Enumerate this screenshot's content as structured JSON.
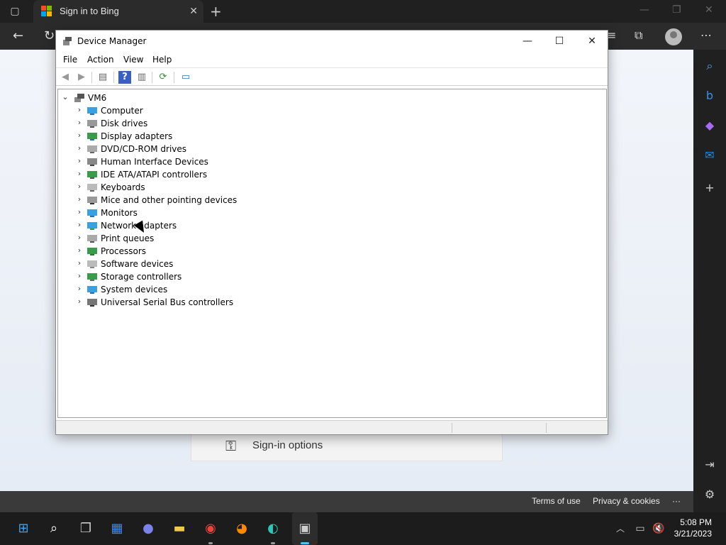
{
  "browser": {
    "tab_title": "Sign in to Bing",
    "new_tab_glyph": "+",
    "close_glyph": "✕"
  },
  "page": {
    "signin_options": "Sign-in options"
  },
  "footer": {
    "terms": "Terms of use",
    "privacy": "Privacy & cookies",
    "more": "···"
  },
  "device_manager": {
    "title": "Device Manager",
    "menu": [
      "File",
      "Action",
      "View",
      "Help"
    ],
    "root": "VM6",
    "categories": [
      {
        "label": "Computer",
        "icon": "computer-icon"
      },
      {
        "label": "Disk drives",
        "icon": "disk-drive-icon"
      },
      {
        "label": "Display adapters",
        "icon": "display-adapter-icon"
      },
      {
        "label": "DVD/CD-ROM drives",
        "icon": "dvd-drive-icon"
      },
      {
        "label": "Human Interface Devices",
        "icon": "hid-icon"
      },
      {
        "label": "IDE ATA/ATAPI controllers",
        "icon": "ide-controller-icon"
      },
      {
        "label": "Keyboards",
        "icon": "keyboard-icon"
      },
      {
        "label": "Mice and other pointing devices",
        "icon": "mouse-icon"
      },
      {
        "label": "Monitors",
        "icon": "monitor-icon"
      },
      {
        "label": "Network adapters",
        "icon": "network-adapter-icon"
      },
      {
        "label": "Print queues",
        "icon": "printer-icon"
      },
      {
        "label": "Processors",
        "icon": "processor-icon"
      },
      {
        "label": "Software devices",
        "icon": "software-device-icon"
      },
      {
        "label": "Storage controllers",
        "icon": "storage-controller-icon"
      },
      {
        "label": "System devices",
        "icon": "system-device-icon"
      },
      {
        "label": "Universal Serial Bus controllers",
        "icon": "usb-icon"
      }
    ]
  },
  "taskbar": {
    "time": "5:08 PM",
    "date": "3/21/2023"
  },
  "colors": {
    "accent": "#0078d4",
    "taskbar": "#1c1c1c",
    "browser_dark": "#202020"
  }
}
